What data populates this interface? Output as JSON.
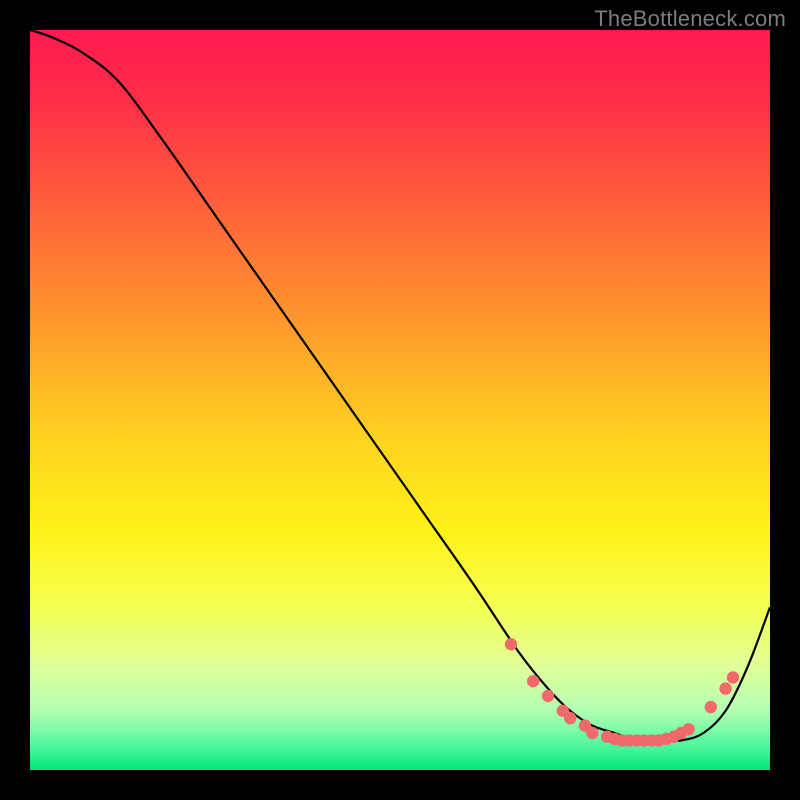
{
  "attribution": "TheBottleneck.com",
  "colors": {
    "background": "#000000",
    "gradient_stops": [
      {
        "offset": 0.0,
        "color": "#ff1a4f"
      },
      {
        "offset": 0.1,
        "color": "#ff2f47"
      },
      {
        "offset": 0.25,
        "color": "#ff653a"
      },
      {
        "offset": 0.4,
        "color": "#ff9a2c"
      },
      {
        "offset": 0.55,
        "color": "#ffd21f"
      },
      {
        "offset": 0.68,
        "color": "#fff21a"
      },
      {
        "offset": 0.78,
        "color": "#f5ff53"
      },
      {
        "offset": 0.86,
        "color": "#e0ff99"
      },
      {
        "offset": 0.92,
        "color": "#b3ffb3"
      },
      {
        "offset": 0.965,
        "color": "#55f7a0"
      },
      {
        "offset": 1.0,
        "color": "#00e67a"
      }
    ],
    "curve": "#000000",
    "markers": "#f06a6a"
  },
  "chart_data": {
    "type": "line",
    "title": "",
    "xlabel": "",
    "ylabel": "",
    "xlim": [
      0,
      100
    ],
    "ylim": [
      0,
      100
    ],
    "series": [
      {
        "name": "curve",
        "x": [
          0,
          3,
          7,
          12,
          18,
          25,
          32,
          39,
          46,
          53,
          60,
          66,
          70,
          73,
          76,
          79,
          82,
          85,
          88,
          91,
          94,
          97,
          100
        ],
        "y": [
          100,
          99,
          97,
          93,
          85,
          75,
          65,
          55,
          45,
          35,
          25,
          16,
          11,
          8,
          6,
          5,
          4,
          4,
          4,
          5,
          8,
          14,
          22
        ]
      }
    ],
    "markers": {
      "name": "bottom-cluster",
      "points": [
        {
          "x": 65,
          "y": 17
        },
        {
          "x": 68,
          "y": 12
        },
        {
          "x": 70,
          "y": 10
        },
        {
          "x": 72,
          "y": 8
        },
        {
          "x": 73,
          "y": 7
        },
        {
          "x": 75,
          "y": 6
        },
        {
          "x": 76,
          "y": 5
        },
        {
          "x": 78,
          "y": 4.5
        },
        {
          "x": 79,
          "y": 4.2
        },
        {
          "x": 80,
          "y": 4
        },
        {
          "x": 81,
          "y": 4
        },
        {
          "x": 82,
          "y": 4
        },
        {
          "x": 83,
          "y": 4
        },
        {
          "x": 84,
          "y": 4
        },
        {
          "x": 85,
          "y": 4
        },
        {
          "x": 86,
          "y": 4.2
        },
        {
          "x": 87,
          "y": 4.5
        },
        {
          "x": 88,
          "y": 5
        },
        {
          "x": 89,
          "y": 5.5
        },
        {
          "x": 92,
          "y": 8.5
        },
        {
          "x": 94,
          "y": 11
        },
        {
          "x": 95,
          "y": 12.5
        }
      ]
    }
  }
}
